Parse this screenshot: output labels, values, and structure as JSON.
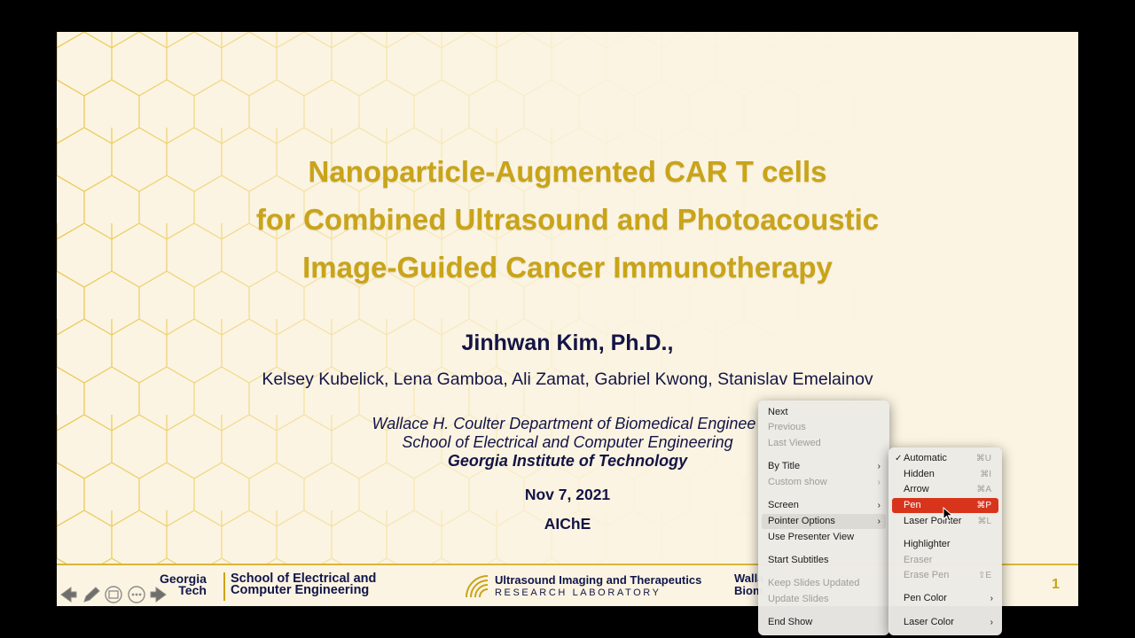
{
  "slide": {
    "title_lines": [
      "Nanoparticle-Augmented CAR T cells",
      "for Combined Ultrasound and Photoacoustic",
      "Image-Guided Cancer Immunotherapy"
    ],
    "presenter": "Jinhwan Kim, Ph.D.,",
    "coauthors": "Kelsey Kubelick, Lena Gamboa, Ali Zamat, Gabriel Kwong, Stanislav Emelainov",
    "affiliation_1": "Wallace H. Coulter Department of Biomedical Enginee",
    "affiliation_2": "School of Electrical and Computer Engineering",
    "affiliation_3": "Georgia Institute of Technology",
    "date": "Nov 7, 2021",
    "conference": "AIChE",
    "page_number": "1",
    "footer": {
      "gt_line1": "Georgia",
      "gt_line2": "Tech",
      "ece_line1": "School of Electrical and",
      "ece_line2": "Computer Engineering",
      "uitl_line1": "Ultrasound Imaging and Therapeutics",
      "uitl_line2": "RESEARCH LABORATORY",
      "bme_line1": "Walla",
      "bme_line2": "Biom"
    },
    "colors": {
      "title": "#c9a419",
      "text": "#141446",
      "background": "#fbf4e2"
    }
  },
  "controls": [
    "prev-icon",
    "pen-icon",
    "slides-icon",
    "more-icon",
    "next-icon"
  ],
  "context_menu": {
    "items": [
      {
        "label": "Next",
        "disabled": false
      },
      {
        "label": "Previous",
        "disabled": true
      },
      {
        "label": "Last Viewed",
        "disabled": true
      },
      {
        "label": "By Title",
        "disabled": false,
        "submenu": true
      },
      {
        "label": "Custom show",
        "disabled": true,
        "submenu": true
      },
      {
        "label": "Screen",
        "disabled": false,
        "submenu": true
      },
      {
        "label": "Pointer Options",
        "disabled": false,
        "submenu": true,
        "selected": true
      },
      {
        "label": "Use Presenter View",
        "disabled": false
      },
      {
        "label": "Start Subtitles",
        "disabled": false
      },
      {
        "label": "Keep Slides Updated",
        "disabled": true
      },
      {
        "label": "Update Slides",
        "disabled": true
      },
      {
        "label": "End Show",
        "disabled": false
      }
    ]
  },
  "pointer_submenu": {
    "items": [
      {
        "label": "Automatic",
        "shortcut": "⌘U",
        "checked": true
      },
      {
        "label": "Hidden",
        "shortcut": "⌘I"
      },
      {
        "label": "Arrow",
        "shortcut": "⌘A"
      },
      {
        "label": "Pen",
        "shortcut": "⌘P",
        "highlighted": true
      },
      {
        "label": "Laser Pointer",
        "shortcut": "⌘L"
      },
      {
        "label": "Highlighter",
        "shortcut": ""
      },
      {
        "label": "Eraser",
        "shortcut": "",
        "disabled": true
      },
      {
        "label": "Erase Pen",
        "shortcut": "⇧E",
        "disabled": true
      },
      {
        "label": "Pen Color",
        "shortcut": "",
        "submenu": true
      },
      {
        "label": "Laser Color",
        "shortcut": "",
        "submenu": true
      }
    ]
  }
}
